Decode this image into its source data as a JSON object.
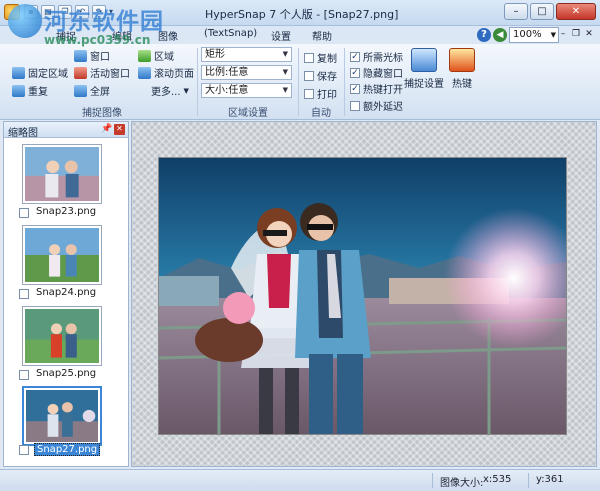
{
  "window": {
    "title": "HyperSnap 7 个人版 - [Snap27.png]",
    "qat_icons": [
      "save-icon",
      "print-icon",
      "copy-icon",
      "undo-icon",
      "redo-icon"
    ]
  },
  "watermark": {
    "title": "河东软件园",
    "url": "www.pc0359.cn"
  },
  "menu": {
    "tabs": [
      "捕捉",
      "编辑",
      "图像",
      "(TextSnap)",
      "设置",
      "帮助"
    ],
    "zoom": "100%"
  },
  "ribbon": {
    "capture": {
      "items": [
        "窗口",
        "固定区域",
        "活动窗口",
        "重复",
        "全屏",
        "滚动页面",
        "更多..."
      ],
      "partial_item": "区域",
      "label": "捕捉图像"
    },
    "region": {
      "shape": "矩形",
      "ratio": "比例:任意",
      "size": "大小:任意",
      "label": "区域设置"
    },
    "auto": {
      "items": [
        {
          "label": "复制",
          "checked": false
        },
        {
          "label": "保存",
          "checked": false
        },
        {
          "label": "打印",
          "checked": false
        }
      ],
      "label": "自动"
    },
    "options": {
      "items": [
        {
          "label": "所需光标",
          "checked": true
        },
        {
          "label": "隐藏窗口",
          "checked": true
        },
        {
          "label": "热键打开",
          "checked": true
        },
        {
          "label": "额外延迟",
          "checked": false
        }
      ]
    },
    "capture_settings_label": "捕捉设置",
    "hotkeys_label": "热键"
  },
  "thumbnails": {
    "title": "缩略图",
    "items": [
      {
        "name": "Snap23.png",
        "selected": false
      },
      {
        "name": "Snap24.png",
        "selected": false
      },
      {
        "name": "Snap25.png",
        "selected": false
      },
      {
        "name": "Snap27.png",
        "selected": true
      }
    ]
  },
  "status": {
    "image_size_label": "图像大小:",
    "x": "x:535",
    "y": "y:361"
  },
  "colors": {
    "accent": "#3d86d6",
    "ribbon_bg": "#dde8f5",
    "close_red": "#c4352a"
  }
}
